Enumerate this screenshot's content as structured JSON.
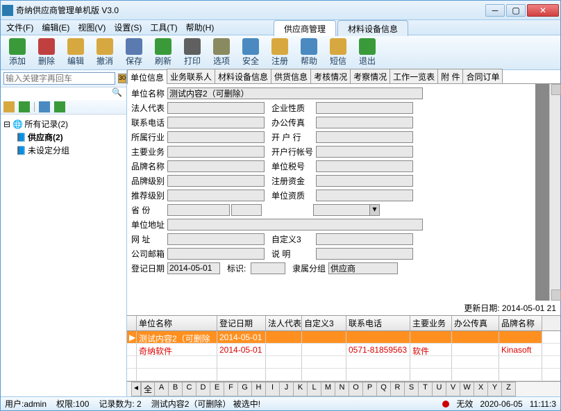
{
  "window": {
    "title": "奇纳供应商管理单机版 V3.0"
  },
  "menu": [
    "文件(F)",
    "编辑(E)",
    "视图(V)",
    "设置(S)",
    "工具(T)",
    "帮助(H)"
  ],
  "toptabs": {
    "active": "供应商管理",
    "items": [
      "供应商管理",
      "材料设备信息"
    ]
  },
  "toolbar": [
    {
      "name": "add",
      "label": "添加",
      "color": "#3a9a3a"
    },
    {
      "name": "delete",
      "label": "删除",
      "color": "#c04040"
    },
    {
      "name": "edit",
      "label": "编辑",
      "color": "#d8a840"
    },
    {
      "name": "undo",
      "label": "撤消",
      "color": "#d8a840"
    },
    {
      "name": "save",
      "label": "保存",
      "color": "#5a7ab0"
    },
    {
      "name": "refresh",
      "label": "刷新",
      "color": "#3a9a3a"
    },
    {
      "name": "print",
      "label": "打印",
      "color": "#606060"
    },
    {
      "name": "option",
      "label": "选项",
      "color": "#8a8a60"
    },
    {
      "name": "security",
      "label": "安全",
      "color": "#4a8ac0"
    },
    {
      "name": "register",
      "label": "注册",
      "color": "#d8a840"
    },
    {
      "name": "help",
      "label": "帮助",
      "color": "#4a8ac0"
    },
    {
      "name": "sms",
      "label": "短信",
      "color": "#d8a840"
    },
    {
      "name": "exit",
      "label": "退出",
      "color": "#3a9a3a"
    }
  ],
  "search": {
    "placeholder": "输入关键字再回车"
  },
  "tree": {
    "root": "所有记录(2)",
    "children": [
      {
        "label": "供应商(2)",
        "bold": true
      },
      {
        "label": "未设定分组"
      }
    ]
  },
  "subtabs": [
    "单位信息",
    "业务联系人",
    "材料设备信息",
    "供货信息",
    "考核情况",
    "考察情况",
    "工作一览表",
    "附        件",
    "合同订单"
  ],
  "form": {
    "单位名称": "测试内容2（可删除）",
    "法人代表": "",
    "企业性质": "",
    "联系电话": "",
    "办公传真": "",
    "所属行业": "",
    "开户行": "",
    "主要业务": "",
    "开户行帐号": "",
    "品牌名称": "",
    "单位税号": "",
    "品牌级别": "",
    "注册资金": "",
    "推荐级别": "",
    "单位资质": "",
    "省份": "",
    "省份2": "",
    "单位地址": "",
    "网址": "",
    "自定义3": "",
    "公司邮箱": "",
    "说明": "",
    "登记日期": "2014-05-01",
    "标识": "",
    "隶属分组": "供应商",
    "更新日期": "更新日期: 2014-05-01 21"
  },
  "labels": {
    "单位名称": "单位名称",
    "法人代表": "法人代表",
    "企业性质": "企业性质",
    "联系电话": "联系电话",
    "办公传真": "办公传真",
    "所属行业": "所属行业",
    "开户行": "开 户 行",
    "主要业务": "主要业务",
    "开户行帐号": "开户行帐号",
    "品牌名称": "品牌名称",
    "单位税号": "单位税号",
    "品牌级别": "品牌级别",
    "注册资金": "注册资金",
    "推荐级别": "推荐级别",
    "单位资质": "单位资质",
    "省份": "省    份",
    "单位地址": "单位地址",
    "网址": "网    址",
    "自定义3": "自定义3",
    "公司邮箱": "公司邮箱",
    "说明": "说    明",
    "登记日期": "登记日期",
    "标识": "标识:",
    "隶属分组": "隶属分组"
  },
  "grid": {
    "headers": [
      "单位名称",
      "登记日期",
      "法人代表",
      "自定义3",
      "联系电话",
      "主要业务",
      "办公传真",
      "品牌名称"
    ],
    "rows": [
      {
        "sel": true,
        "单位名称": "测试内容2（可删除",
        "登记日期": "2014-05-01",
        "法人代表": "",
        "自定义3": "",
        "联系电话": "",
        "主要业务": "",
        "办公传真": "",
        "品牌名称": ""
      },
      {
        "red": true,
        "单位名称": "奇纳软件",
        "登记日期": "2014-05-01",
        "法人代表": "",
        "自定义3": "",
        "联系电话": "0571-81859563",
        "主要业务": "软件",
        "办公传真": "",
        "品牌名称": "Kinasoft"
      }
    ]
  },
  "alpha": {
    "all": "全",
    "letters": [
      "A",
      "B",
      "C",
      "D",
      "E",
      "F",
      "G",
      "H",
      "I",
      "J",
      "K",
      "L",
      "M",
      "N",
      "O",
      "P",
      "Q",
      "R",
      "S",
      "T",
      "U",
      "V",
      "W",
      "X",
      "Y",
      "Z"
    ]
  },
  "status": {
    "user": "用户:admin",
    "perm": "权限:100",
    "count": "记录数为: 2",
    "sel": "测试内容2（可删除） 被选中!",
    "invalid": "无效",
    "date": "2020-06-05",
    "time": "11:11:3"
  }
}
